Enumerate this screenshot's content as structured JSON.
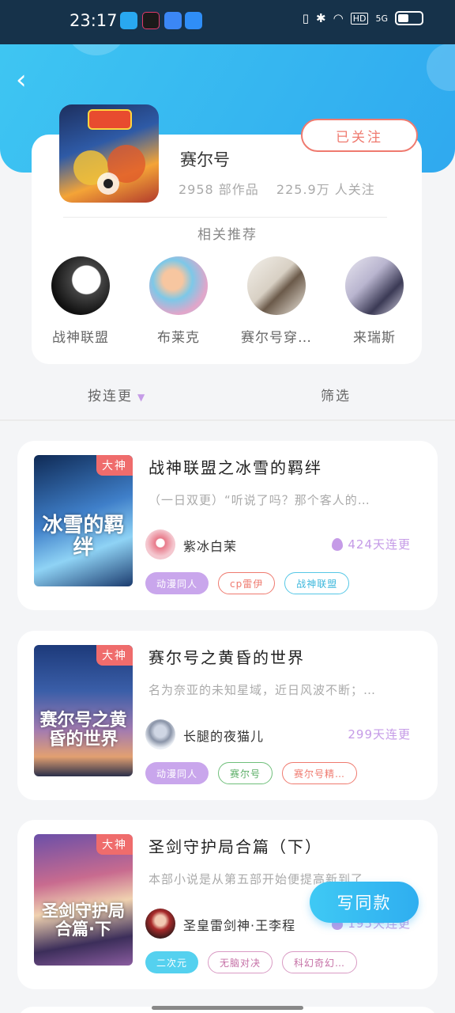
{
  "status_bar": {
    "time": "23:17",
    "network": "HD",
    "signal": "5G"
  },
  "author": {
    "name": "赛尔号",
    "works": "2958 部作品",
    "followers": "225.9万 人关注",
    "follow_label": "已关注"
  },
  "recommend": {
    "title": "相关推荐",
    "items": [
      {
        "label": "战神联盟"
      },
      {
        "label": "布莱克"
      },
      {
        "label": "赛尔号穿…"
      },
      {
        "label": "来瑞斯"
      }
    ]
  },
  "toolbar": {
    "sort_label": "按连更",
    "filter_label": "筛选"
  },
  "books": [
    {
      "badge": "大神",
      "cover_title": "冰雪的羁绊",
      "title": "战神联盟之冰雪的羁绊",
      "desc": "（一日双更）“听说了吗？那个客人的…",
      "author": "紫冰白茉",
      "update": "424天连更",
      "tags": [
        "动漫同人",
        "cp雷伊",
        "战神联盟"
      ]
    },
    {
      "badge": "大神",
      "cover_title": "赛尔号之黄昏的世界",
      "title": "赛尔号之黄昏的世界",
      "desc": "名为奈亚的未知星域，近日风波不断；…",
      "author": "长腿的夜猫儿",
      "update": "299天连更",
      "tags": [
        "动漫同人",
        "赛尔号",
        "赛尔号精…"
      ]
    },
    {
      "badge": "大神",
      "cover_title": "圣剑守护局 合篇·下",
      "title": "圣剑守护局合篇（下）",
      "desc": "本部小说是从第五部开始便提高新到了…",
      "author": "圣皇雷剑神·王李程",
      "update": "195天连更",
      "tags": [
        "二次元",
        "无脑对决",
        "科幻奇幻…"
      ]
    }
  ],
  "write_button": "写同款",
  "colors": {
    "accent": "#2faef0",
    "follow": "#ef7a6f",
    "purple": "#c59be7"
  }
}
